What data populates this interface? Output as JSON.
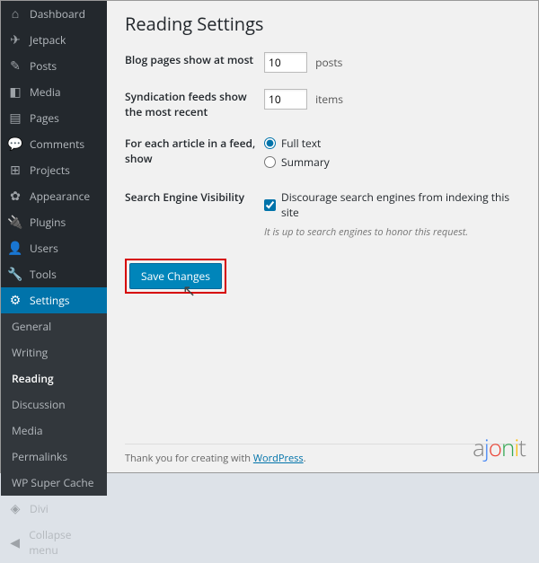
{
  "sidebar": {
    "top": [
      {
        "icon": "⌂",
        "label": "Dashboard"
      },
      {
        "icon": "✈",
        "label": "Jetpack"
      }
    ],
    "main": [
      {
        "icon": "✎",
        "label": "Posts"
      },
      {
        "icon": "◧",
        "label": "Media"
      },
      {
        "icon": "▤",
        "label": "Pages"
      },
      {
        "icon": "💬",
        "label": "Comments"
      },
      {
        "icon": "⊞",
        "label": "Projects"
      }
    ],
    "admin": [
      {
        "icon": "✿",
        "label": "Appearance"
      },
      {
        "icon": "🔌",
        "label": "Plugins"
      },
      {
        "icon": "👤",
        "label": "Users"
      },
      {
        "icon": "🔧",
        "label": "Tools"
      },
      {
        "icon": "⚙",
        "label": "Settings",
        "active": true
      }
    ],
    "sub": [
      {
        "label": "General"
      },
      {
        "label": "Writing"
      },
      {
        "label": "Reading",
        "current": true
      },
      {
        "label": "Discussion"
      },
      {
        "label": "Media"
      },
      {
        "label": "Permalinks"
      },
      {
        "label": "WP Super Cache"
      }
    ],
    "bottom": [
      {
        "icon": "◈",
        "label": "Divi"
      },
      {
        "icon": "◀",
        "label": "Collapse menu"
      }
    ]
  },
  "page": {
    "title": "Reading Settings",
    "rows": {
      "blog_pages": {
        "label": "Blog pages show at most",
        "value": "10",
        "suffix": "posts"
      },
      "syndication": {
        "label": "Syndication feeds show the most recent",
        "value": "10",
        "suffix": "items"
      },
      "feed_show": {
        "label": "For each article in a feed, show",
        "opt_full": "Full text",
        "opt_summary": "Summary"
      },
      "visibility": {
        "label": "Search Engine Visibility",
        "checkbox": "Discourage search engines from indexing this site",
        "note": "It is up to search engines to honor this request."
      }
    },
    "save_label": "Save Changes"
  },
  "footer": {
    "text": "Thank you for creating with ",
    "link": "WordPress"
  },
  "logo": "ajonit"
}
